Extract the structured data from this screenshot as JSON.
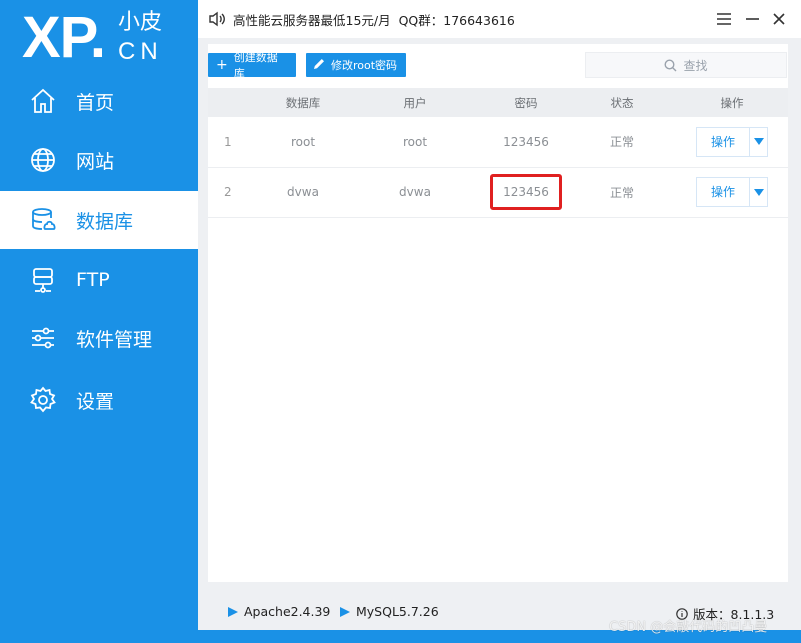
{
  "logo": {
    "mark": "XP.",
    "top": "小皮",
    "bottom": "CN"
  },
  "sidebar": {
    "items": [
      {
        "label": "首页",
        "icon": "home-icon"
      },
      {
        "label": "网站",
        "icon": "globe-icon"
      },
      {
        "label": "数据库",
        "icon": "database-icon",
        "active": true
      },
      {
        "label": "FTP",
        "icon": "ftp-server-icon"
      },
      {
        "label": "软件管理",
        "icon": "sliders-icon"
      },
      {
        "label": "设置",
        "icon": "gear-icon"
      }
    ]
  },
  "titlebar": {
    "notice": "高性能云服务器最低15元/月  QQ群：176643616"
  },
  "toolbar": {
    "create_label": "创建数据库",
    "root_label": "修改root密码"
  },
  "search": {
    "placeholder": "查找"
  },
  "table": {
    "headers": [
      "",
      "数据库",
      "用户",
      "密码",
      "状态",
      "操作"
    ],
    "rows": [
      {
        "num": "1",
        "db": "root",
        "user": "root",
        "pwd": "123456",
        "status": "正常",
        "op": "操作"
      },
      {
        "num": "2",
        "db": "dvwa",
        "user": "dvwa",
        "pwd": "123456",
        "status": "正常",
        "op": "操作"
      }
    ]
  },
  "status": {
    "apache": "Apache2.4.39",
    "mysql": "MySQL5.7.26",
    "version": "版本：8.1.1.3"
  },
  "watermark": "CSDN @会敲代码的凹凸曼",
  "colors": {
    "accent": "#1a91e6",
    "highlight": "#e02020"
  }
}
